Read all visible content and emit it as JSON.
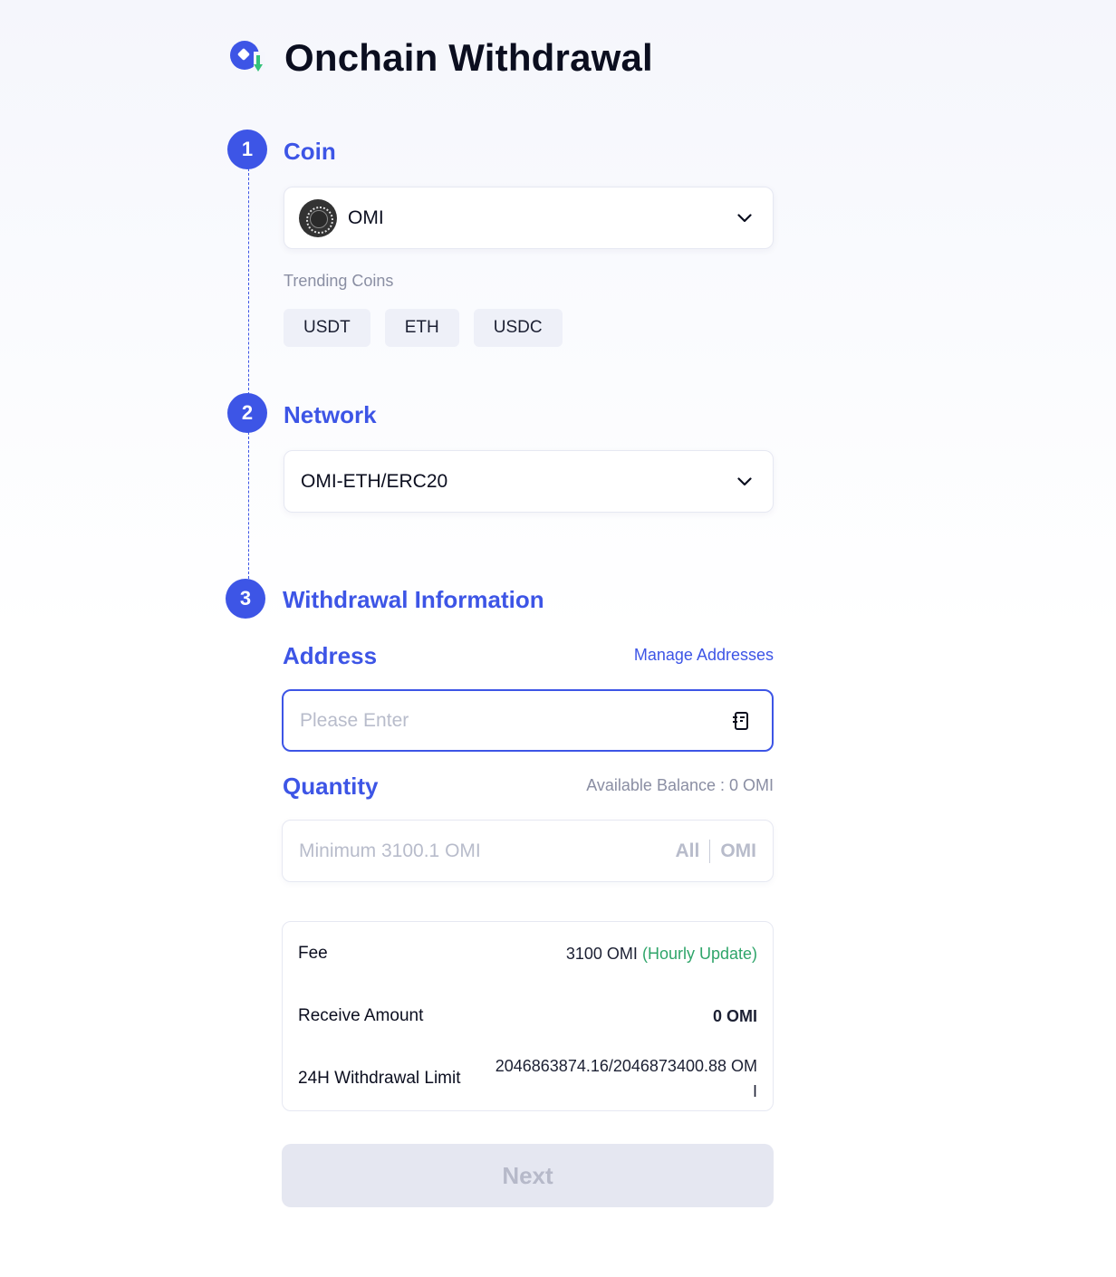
{
  "header": {
    "title": "Onchain Withdrawal",
    "logo_icon": "withdraw-coin-arrow-down-icon"
  },
  "colors": {
    "accent": "#3d55e6",
    "success": "#2fa56a",
    "danger": "#d23f3f",
    "muted": "#8a8ea3",
    "disabled_bg": "#e5e7f1"
  },
  "steps": [
    {
      "number": "1",
      "title": "Coin"
    },
    {
      "number": "2",
      "title": "Network"
    },
    {
      "number": "3",
      "title": "Withdrawal Information"
    }
  ],
  "coin": {
    "selected": "OMI",
    "icon": "omi-coin-icon",
    "trending_label": "Trending Coins",
    "trending": [
      "USDT",
      "ETH",
      "USDC"
    ]
  },
  "network": {
    "selected": "OMI-ETH/ERC20"
  },
  "withdrawal": {
    "address": {
      "label": "Address",
      "manage_link": "Manage Addresses",
      "placeholder": "Please Enter",
      "value": ""
    },
    "quantity": {
      "label": "Quantity",
      "available_balance": "Available Balance : 0 OMI",
      "placeholder": "Minimum 3100.1 OMI",
      "value": "",
      "all_label": "All",
      "unit": "OMI"
    },
    "summary": {
      "fee_label": "Fee",
      "fee_value": "3100 OMI",
      "fee_note": "(Hourly Update)",
      "receive_label": "Receive Amount",
      "receive_value": "0 OMI",
      "limit_label": "24H Withdrawal Limit",
      "limit_value": "2046863874.16/2046873400.88 OMI"
    },
    "next_button": "Next"
  }
}
